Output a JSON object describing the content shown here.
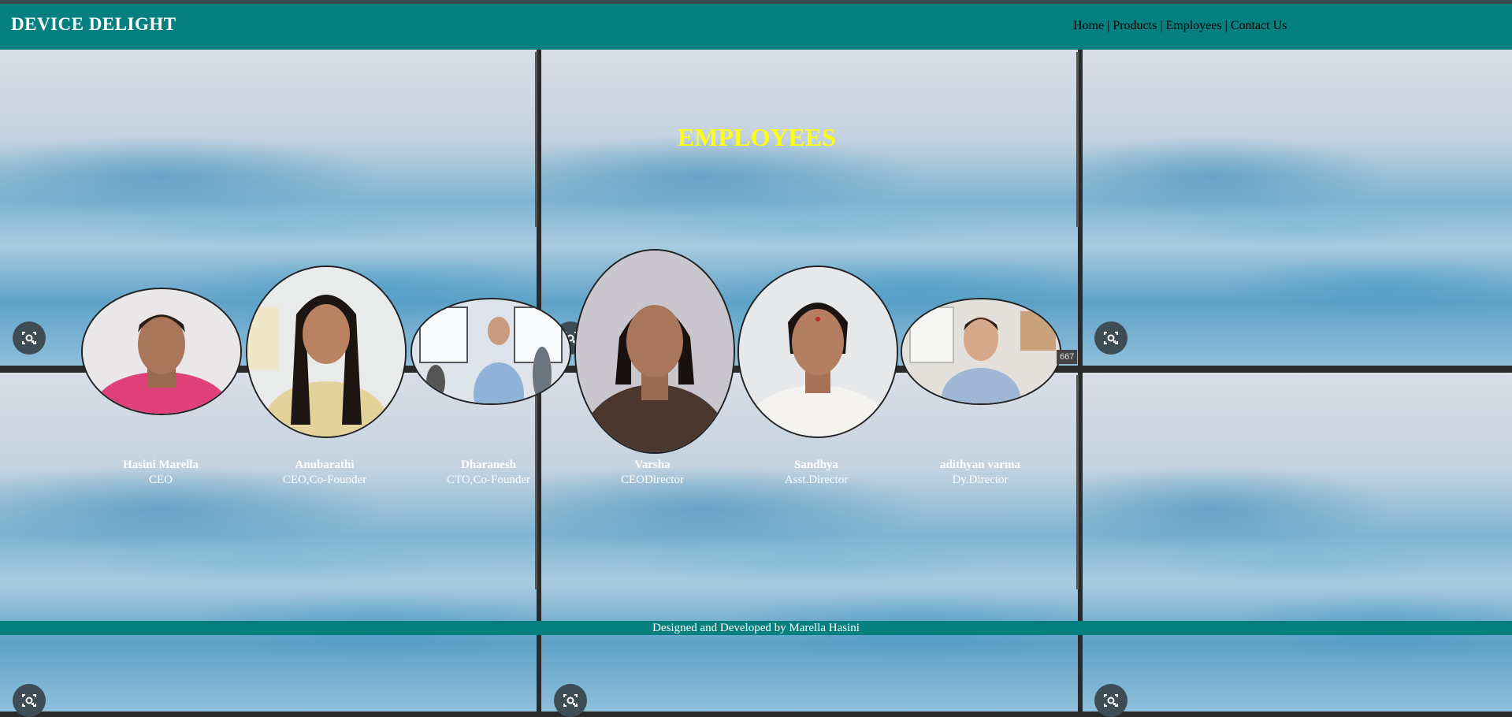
{
  "header": {
    "brand": "DEVICE DELIGHT",
    "nav": [
      {
        "label": "Home"
      },
      {
        "label": "Products"
      },
      {
        "label": "Employees"
      },
      {
        "label": "Contact Us"
      }
    ],
    "separator": " | "
  },
  "main": {
    "title": "EMPLOYEES",
    "employees": [
      {
        "name": "Hasini Marella",
        "role": "CEO"
      },
      {
        "name": "Anubarathi",
        "role": "CEO,Co-Founder"
      },
      {
        "name": "Dharanesh",
        "role": "CTO,Co-Founder"
      },
      {
        "name": "Varsha",
        "role": "CEODirector"
      },
      {
        "name": "Sandhya",
        "role": "Asst.Director"
      },
      {
        "name": "adithyan varma",
        "role": "Dy.Director"
      }
    ]
  },
  "footer": {
    "text": "Designed and Developed by Marella Hasini"
  },
  "overlay": {
    "badge": "667"
  },
  "colors": {
    "header_bg": "#067f7f",
    "title": "#ffff14",
    "text": "#ffffff"
  },
  "icons": [
    "lens-camera-icon"
  ]
}
